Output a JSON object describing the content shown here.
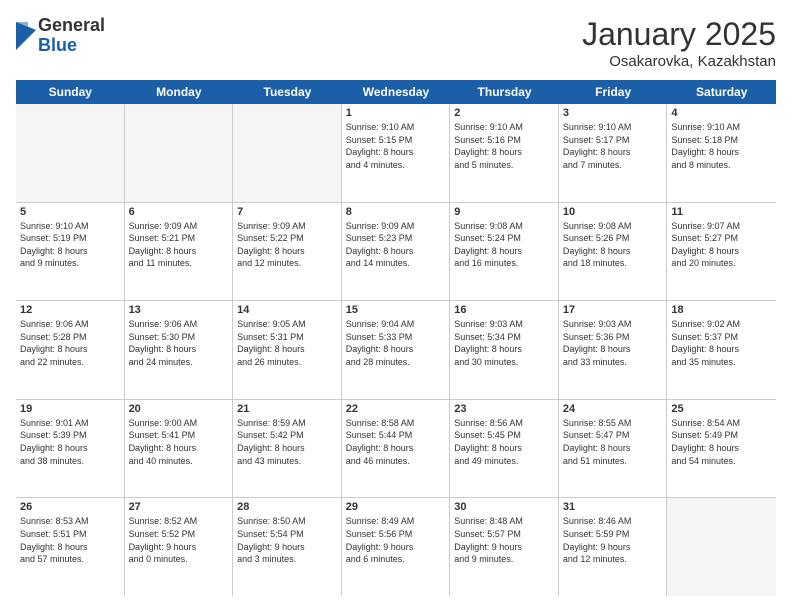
{
  "logo": {
    "general": "General",
    "blue": "Blue"
  },
  "title": "January 2025",
  "location": "Osakarovka, Kazakhstan",
  "days": [
    "Sunday",
    "Monday",
    "Tuesday",
    "Wednesday",
    "Thursday",
    "Friday",
    "Saturday"
  ],
  "rows": [
    [
      {
        "day": "",
        "empty": true
      },
      {
        "day": "",
        "empty": true
      },
      {
        "day": "",
        "empty": true
      },
      {
        "day": "1",
        "lines": [
          "Sunrise: 9:10 AM",
          "Sunset: 5:15 PM",
          "Daylight: 8 hours",
          "and 4 minutes."
        ]
      },
      {
        "day": "2",
        "lines": [
          "Sunrise: 9:10 AM",
          "Sunset: 5:16 PM",
          "Daylight: 8 hours",
          "and 5 minutes."
        ]
      },
      {
        "day": "3",
        "lines": [
          "Sunrise: 9:10 AM",
          "Sunset: 5:17 PM",
          "Daylight: 8 hours",
          "and 7 minutes."
        ]
      },
      {
        "day": "4",
        "lines": [
          "Sunrise: 9:10 AM",
          "Sunset: 5:18 PM",
          "Daylight: 8 hours",
          "and 8 minutes."
        ]
      }
    ],
    [
      {
        "day": "5",
        "lines": [
          "Sunrise: 9:10 AM",
          "Sunset: 5:19 PM",
          "Daylight: 8 hours",
          "and 9 minutes."
        ]
      },
      {
        "day": "6",
        "lines": [
          "Sunrise: 9:09 AM",
          "Sunset: 5:21 PM",
          "Daylight: 8 hours",
          "and 11 minutes."
        ]
      },
      {
        "day": "7",
        "lines": [
          "Sunrise: 9:09 AM",
          "Sunset: 5:22 PM",
          "Daylight: 8 hours",
          "and 12 minutes."
        ]
      },
      {
        "day": "8",
        "lines": [
          "Sunrise: 9:09 AM",
          "Sunset: 5:23 PM",
          "Daylight: 8 hours",
          "and 14 minutes."
        ]
      },
      {
        "day": "9",
        "lines": [
          "Sunrise: 9:08 AM",
          "Sunset: 5:24 PM",
          "Daylight: 8 hours",
          "and 16 minutes."
        ]
      },
      {
        "day": "10",
        "lines": [
          "Sunrise: 9:08 AM",
          "Sunset: 5:26 PM",
          "Daylight: 8 hours",
          "and 18 minutes."
        ]
      },
      {
        "day": "11",
        "lines": [
          "Sunrise: 9:07 AM",
          "Sunset: 5:27 PM",
          "Daylight: 8 hours",
          "and 20 minutes."
        ]
      }
    ],
    [
      {
        "day": "12",
        "lines": [
          "Sunrise: 9:06 AM",
          "Sunset: 5:28 PM",
          "Daylight: 8 hours",
          "and 22 minutes."
        ]
      },
      {
        "day": "13",
        "lines": [
          "Sunrise: 9:06 AM",
          "Sunset: 5:30 PM",
          "Daylight: 8 hours",
          "and 24 minutes."
        ]
      },
      {
        "day": "14",
        "lines": [
          "Sunrise: 9:05 AM",
          "Sunset: 5:31 PM",
          "Daylight: 8 hours",
          "and 26 minutes."
        ]
      },
      {
        "day": "15",
        "lines": [
          "Sunrise: 9:04 AM",
          "Sunset: 5:33 PM",
          "Daylight: 8 hours",
          "and 28 minutes."
        ]
      },
      {
        "day": "16",
        "lines": [
          "Sunrise: 9:03 AM",
          "Sunset: 5:34 PM",
          "Daylight: 8 hours",
          "and 30 minutes."
        ]
      },
      {
        "day": "17",
        "lines": [
          "Sunrise: 9:03 AM",
          "Sunset: 5:36 PM",
          "Daylight: 8 hours",
          "and 33 minutes."
        ]
      },
      {
        "day": "18",
        "lines": [
          "Sunrise: 9:02 AM",
          "Sunset: 5:37 PM",
          "Daylight: 8 hours",
          "and 35 minutes."
        ]
      }
    ],
    [
      {
        "day": "19",
        "lines": [
          "Sunrise: 9:01 AM",
          "Sunset: 5:39 PM",
          "Daylight: 8 hours",
          "and 38 minutes."
        ]
      },
      {
        "day": "20",
        "lines": [
          "Sunrise: 9:00 AM",
          "Sunset: 5:41 PM",
          "Daylight: 8 hours",
          "and 40 minutes."
        ]
      },
      {
        "day": "21",
        "lines": [
          "Sunrise: 8:59 AM",
          "Sunset: 5:42 PM",
          "Daylight: 8 hours",
          "and 43 minutes."
        ]
      },
      {
        "day": "22",
        "lines": [
          "Sunrise: 8:58 AM",
          "Sunset: 5:44 PM",
          "Daylight: 8 hours",
          "and 46 minutes."
        ]
      },
      {
        "day": "23",
        "lines": [
          "Sunrise: 8:56 AM",
          "Sunset: 5:45 PM",
          "Daylight: 8 hours",
          "and 49 minutes."
        ]
      },
      {
        "day": "24",
        "lines": [
          "Sunrise: 8:55 AM",
          "Sunset: 5:47 PM",
          "Daylight: 8 hours",
          "and 51 minutes."
        ]
      },
      {
        "day": "25",
        "lines": [
          "Sunrise: 8:54 AM",
          "Sunset: 5:49 PM",
          "Daylight: 8 hours",
          "and 54 minutes."
        ]
      }
    ],
    [
      {
        "day": "26",
        "lines": [
          "Sunrise: 8:53 AM",
          "Sunset: 5:51 PM",
          "Daylight: 8 hours",
          "and 57 minutes."
        ]
      },
      {
        "day": "27",
        "lines": [
          "Sunrise: 8:52 AM",
          "Sunset: 5:52 PM",
          "Daylight: 9 hours",
          "and 0 minutes."
        ]
      },
      {
        "day": "28",
        "lines": [
          "Sunrise: 8:50 AM",
          "Sunset: 5:54 PM",
          "Daylight: 9 hours",
          "and 3 minutes."
        ]
      },
      {
        "day": "29",
        "lines": [
          "Sunrise: 8:49 AM",
          "Sunset: 5:56 PM",
          "Daylight: 9 hours",
          "and 6 minutes."
        ]
      },
      {
        "day": "30",
        "lines": [
          "Sunrise: 8:48 AM",
          "Sunset: 5:57 PM",
          "Daylight: 9 hours",
          "and 9 minutes."
        ]
      },
      {
        "day": "31",
        "lines": [
          "Sunrise: 8:46 AM",
          "Sunset: 5:59 PM",
          "Daylight: 9 hours",
          "and 12 minutes."
        ]
      },
      {
        "day": "",
        "empty": true
      }
    ]
  ]
}
